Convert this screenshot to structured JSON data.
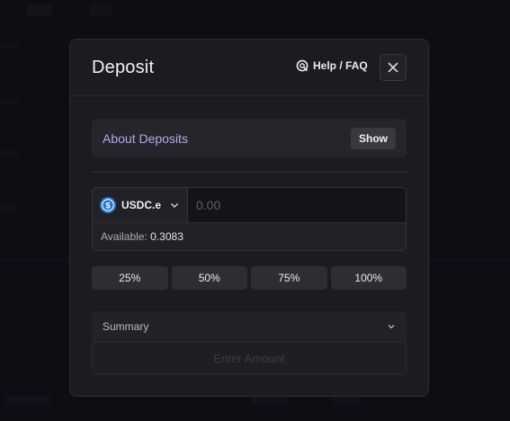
{
  "modal": {
    "title": "Deposit",
    "help_label": "Help / FAQ",
    "about": {
      "label": "About Deposits",
      "show_label": "Show"
    },
    "token": {
      "symbol": "USDC.e",
      "icon": "usdc-token-icon"
    },
    "amount": {
      "placeholder": "0.00",
      "value": ""
    },
    "available": {
      "label": "Available:",
      "value": "0.3083"
    },
    "percent_buttons": [
      "25%",
      "50%",
      "75%",
      "100%"
    ],
    "summary_label": "Summary",
    "submit_label": "Enter Amount"
  },
  "colors": {
    "modal_bg": "#1c1b20",
    "accent_text": "#b9a7e6",
    "token_blue": "#2775ca"
  }
}
